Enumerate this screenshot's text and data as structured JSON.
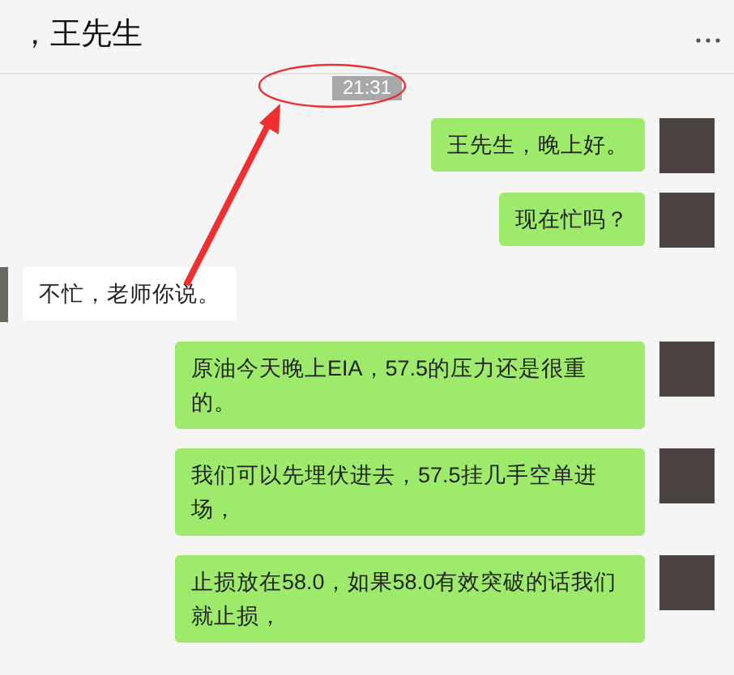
{
  "header": {
    "title": "，王先生"
  },
  "timestamp": "21:31",
  "messages": [
    {
      "kind": "sent",
      "text": "王先生，晚上好。"
    },
    {
      "kind": "sent",
      "text": "现在忙吗？"
    },
    {
      "kind": "received",
      "text": "不忙，老师你说。"
    },
    {
      "kind": "sent",
      "text": "原油今天晚上EIA，57.5的压力还是很重的。"
    },
    {
      "kind": "sent",
      "text": "我们可以先埋伏进去，57.5挂几手空单进场，"
    },
    {
      "kind": "sent",
      "text": "止损放在58.0，如果58.0有效突破的话我们就止损，"
    }
  ]
}
